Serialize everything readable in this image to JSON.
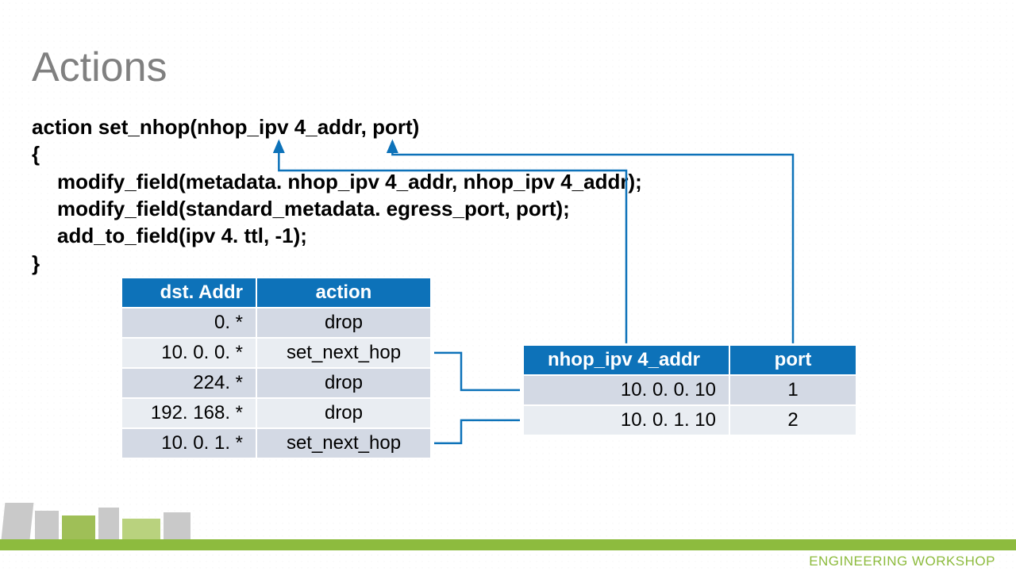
{
  "title": "Actions",
  "code": {
    "line1_a": "action set_nhop(",
    "line1_b": "nhop_ipv 4_addr",
    "line1_c": ", ",
    "line1_d": "port",
    "line1_e": ")",
    "line2": "{",
    "line3": "modify_field(metadata. nhop_ipv 4_addr, nhop_ipv 4_addr);",
    "line4": "modify_field(standard_metadata. egress_port, port);",
    "line5": "add_to_field(ipv 4. ttl, -1);",
    "line6": "}"
  },
  "table1": {
    "headers": [
      "dst. Addr",
      "action"
    ],
    "rows": [
      [
        "0. *",
        "drop"
      ],
      [
        "10. 0. 0. *",
        "set_next_hop"
      ],
      [
        "224. *",
        "drop"
      ],
      [
        "192. 168. *",
        "drop"
      ],
      [
        "10. 0. 1. *",
        "set_next_hop"
      ]
    ]
  },
  "table2": {
    "headers": [
      "nhop_ipv 4_addr",
      "port"
    ],
    "rows": [
      [
        "10. 0. 0. 10",
        "1"
      ],
      [
        "10. 0. 1. 10",
        "2"
      ]
    ]
  },
  "footer": "ENGINEERING WORKSHOP"
}
